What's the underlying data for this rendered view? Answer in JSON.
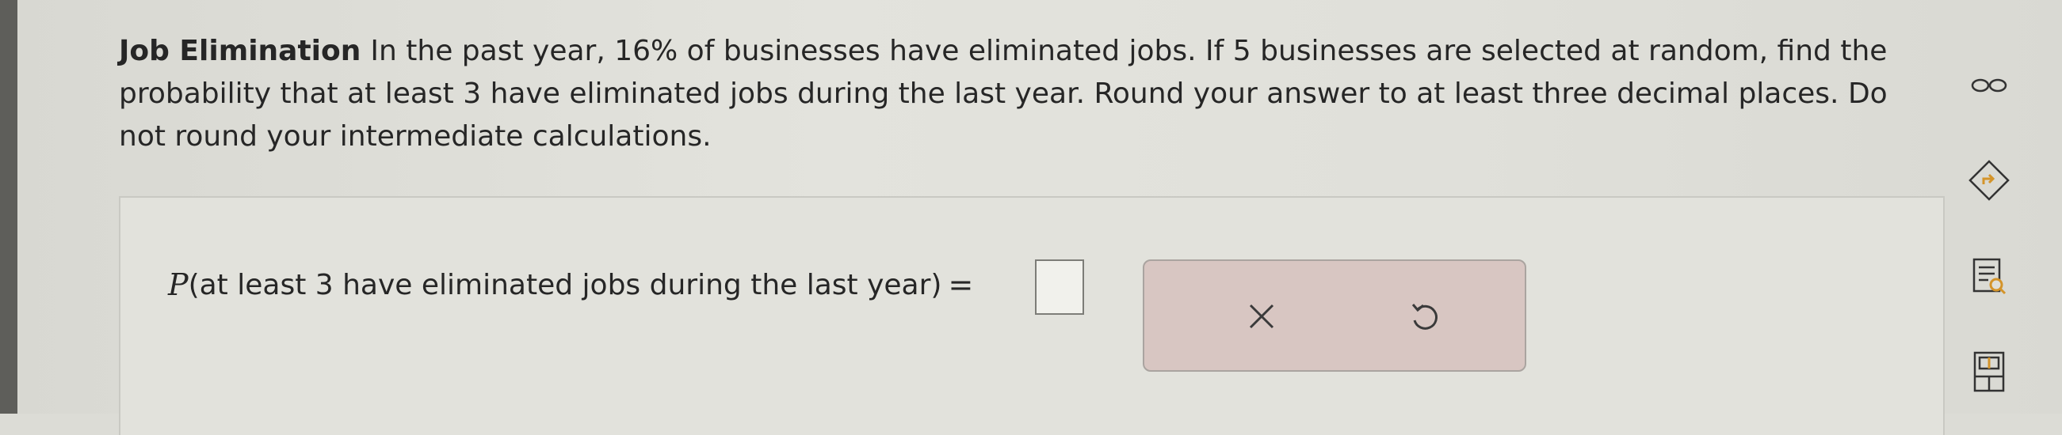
{
  "question": {
    "title": "Job Elimination",
    "body": "In the past year, 16% of businesses have eliminated jobs. If 5 businesses are selected at random, find the probability that at least 3 have eliminated jobs during the last year. Round your answer to at least three decimal places. Do not round your intermediate calculations."
  },
  "answer": {
    "prob_symbol": "P",
    "prob_text": "(at least 3 have eliminated jobs during the last year)",
    "equals": "=",
    "value": ""
  },
  "actions": {
    "clear_icon": "close-icon",
    "undo_icon": "undo-icon"
  },
  "side_tools": {
    "icons": [
      "infinity-icon",
      "direction-sign-icon",
      "list-search-icon",
      "calculator-icon"
    ]
  },
  "colors": {
    "action_box_bg": "#d8c6c2",
    "icon_orange": "#d4942a"
  }
}
